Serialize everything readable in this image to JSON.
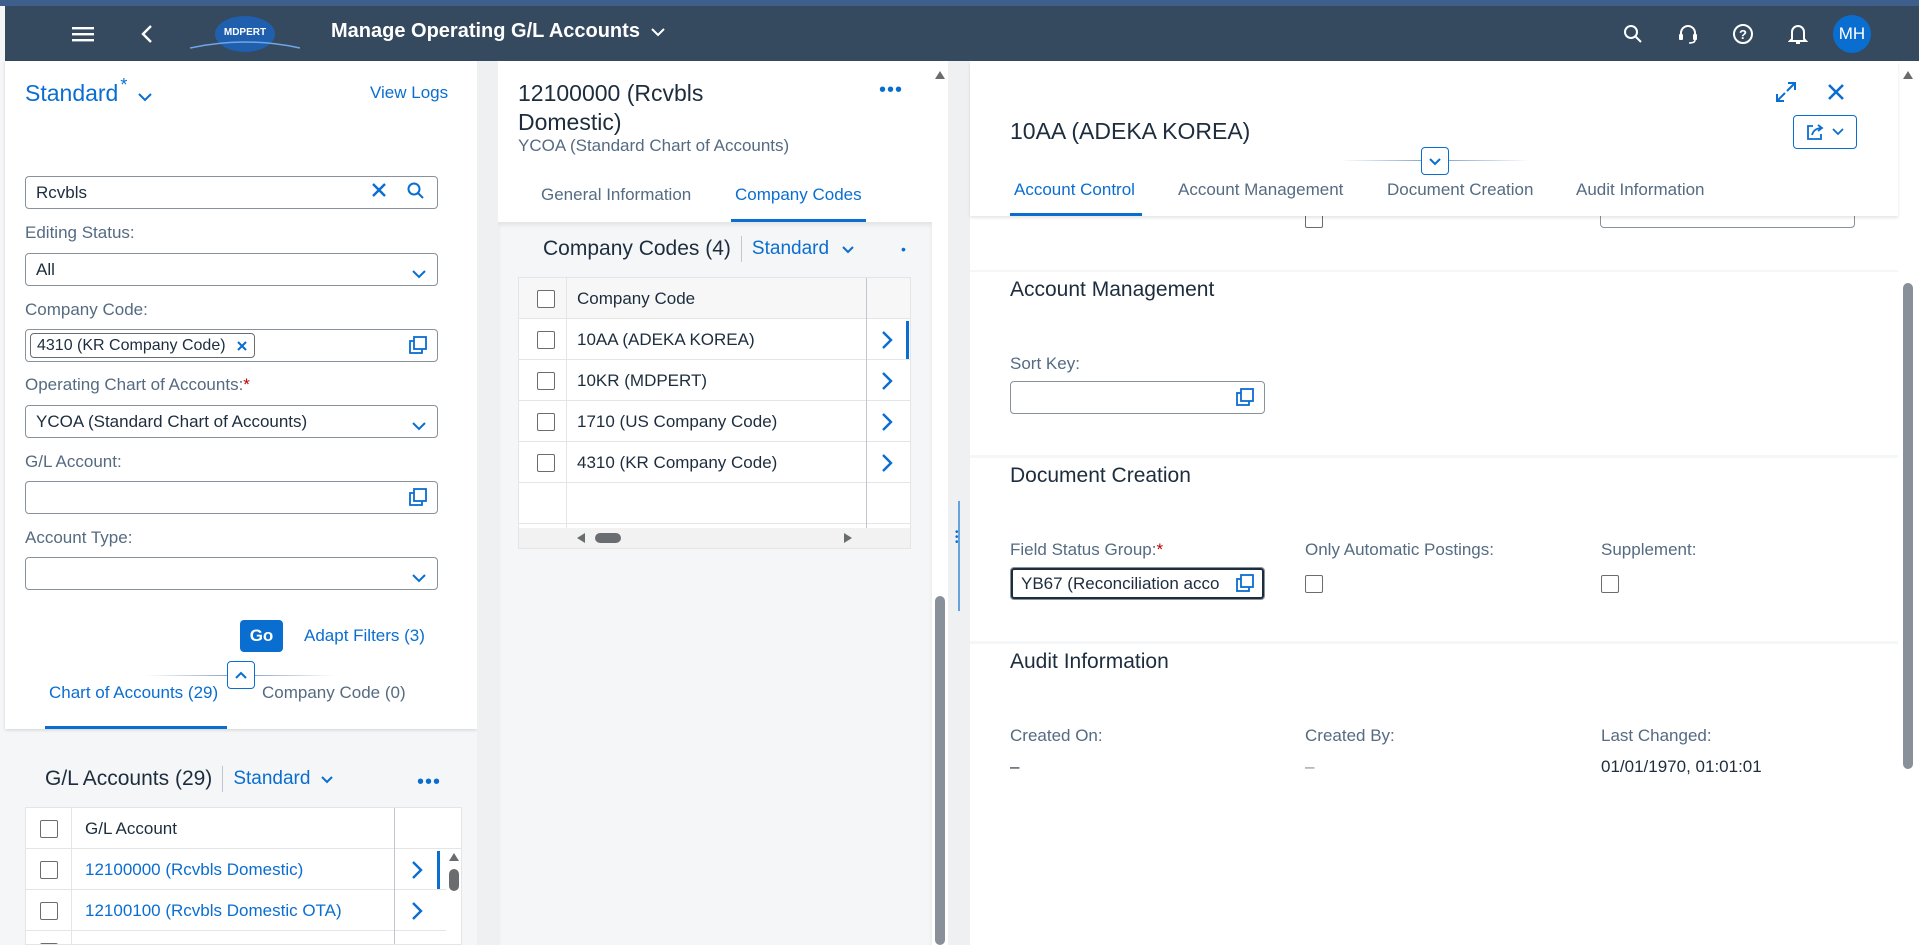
{
  "shell": {
    "title": "Manage Operating G/L Accounts",
    "logo_text": "MDPERT",
    "avatar": "MH",
    "icons": [
      "menu-icon",
      "back-icon",
      "search-icon",
      "help-headset-icon",
      "help-icon",
      "notification-icon"
    ]
  },
  "filterbar": {
    "variant": "Standard",
    "variant_mark": "*",
    "view_logs": "View Logs",
    "search_value": "Rcvbls",
    "editing_status_label": "Editing Status:",
    "editing_status_value": "All",
    "company_code_label": "Company Code:",
    "company_code_token": "4310 (KR Company Code)",
    "chart_label": "Operating Chart of Accounts:",
    "required_mark": "*",
    "chart_value": "YCOA (Standard Chart of Accounts)",
    "gl_account_label": "G/L Account:",
    "gl_account_value": "",
    "account_type_label": "Account Type:",
    "account_type_value": "",
    "go_label": "Go",
    "adapt_filters": "Adapt Filters (3)",
    "tabs": [
      "Chart of Accounts (29)",
      "Company Code (0)"
    ]
  },
  "gl_list": {
    "title": "G/L Accounts (29)",
    "variant": "Standard",
    "column": "G/L Account",
    "rows": [
      "12100000 (Rcvbls Domestic)",
      "12100100 (Rcvbls Domestic OTA)"
    ]
  },
  "detail": {
    "title_line1": "12100000 (Rcvbls",
    "title_line2": "Domestic)",
    "subtitle": "YCOA (Standard Chart of Accounts)",
    "tabs": [
      "General Information",
      "Company Codes"
    ],
    "table_title": "Company Codes (4)",
    "table_variant": "Standard",
    "column": "Company Code",
    "rows": [
      "10AA (ADEKA KOREA)",
      "10KR (MDPERT)",
      "1710 (US Company Code)",
      "4310 (KR Company Code)"
    ]
  },
  "object": {
    "title": "10AA (ADEKA KOREA)",
    "tabs": [
      "Account Control",
      "Account Management",
      "Document Creation",
      "Audit Information"
    ],
    "account_management": {
      "title": "Account Management",
      "sort_key_label": "Sort Key:",
      "sort_key_value": ""
    },
    "document_creation": {
      "title": "Document Creation",
      "fsg_label": "Field Status Group:",
      "required_mark": "*",
      "fsg_value": "YB67 (Reconciliation acco",
      "auto_label": "Only Automatic Postings:",
      "supplement_label": "Supplement:"
    },
    "audit": {
      "title": "Audit Information",
      "created_on_label": "Created On:",
      "created_on_value": "–",
      "created_by_label": "Created By:",
      "created_by_value": "–",
      "last_changed_label": "Last Changed:",
      "last_changed_value": "01/01/1970, 01:01:01"
    }
  },
  "colors": {
    "shell": "#354a5f",
    "brand": "#0a6ed1",
    "required": "#bb0000"
  }
}
